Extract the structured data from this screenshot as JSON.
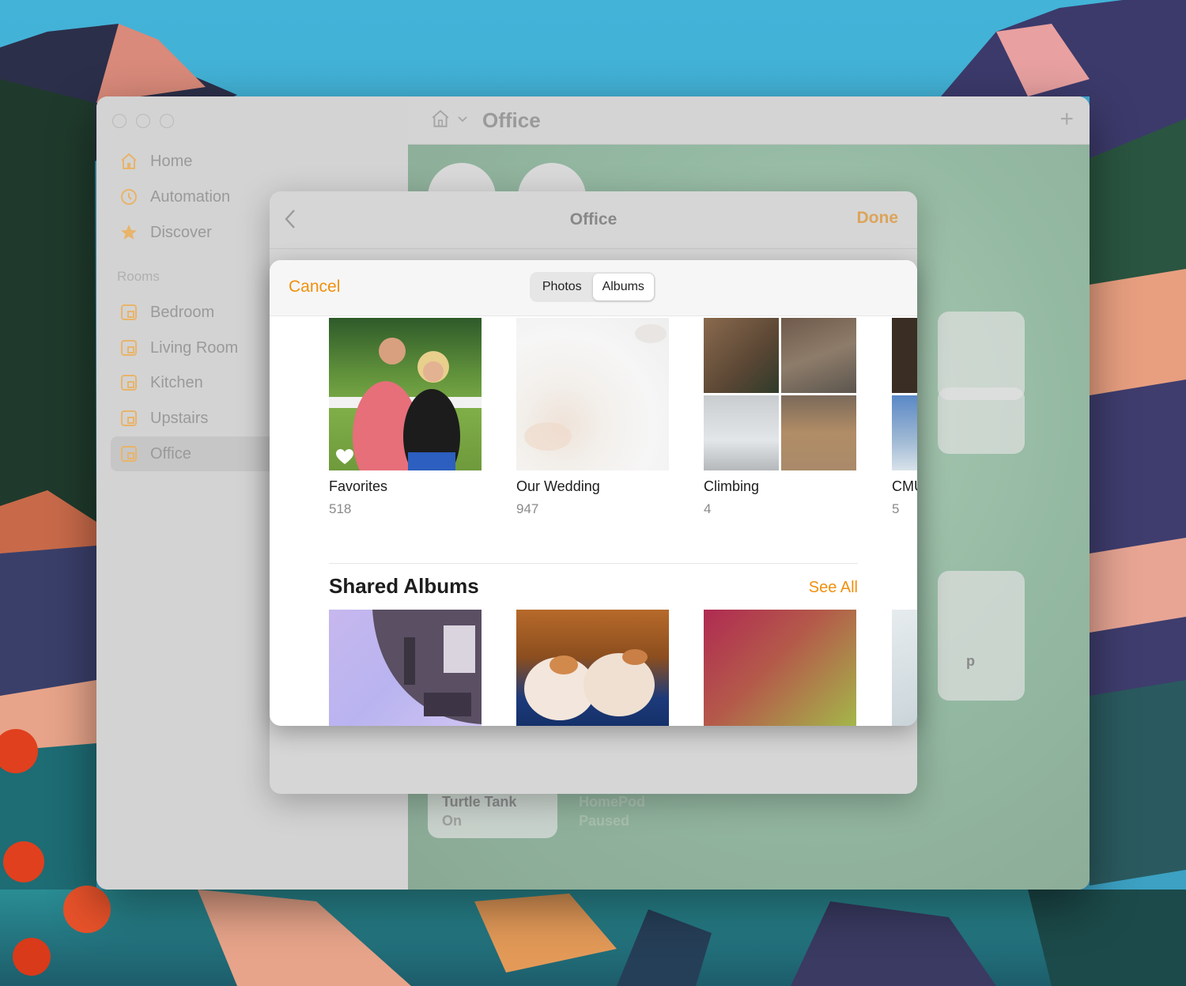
{
  "window": {
    "title": "Office"
  },
  "sidebar": {
    "items": [
      {
        "label": "Home",
        "icon": "house-icon"
      },
      {
        "label": "Automation",
        "icon": "clock-icon"
      },
      {
        "label": "Discover",
        "icon": "star-icon"
      }
    ],
    "rooms_header": "Rooms",
    "rooms": [
      {
        "label": "Bedroom"
      },
      {
        "label": "Living Room"
      },
      {
        "label": "Kitchen"
      },
      {
        "label": "Upstairs"
      },
      {
        "label": "Office",
        "selected": true
      }
    ]
  },
  "main": {
    "tiles": [
      {
        "name": "Turtle Tank",
        "status": "On"
      },
      {
        "name": "HomePod",
        "status": "Paused"
      }
    ],
    "partial_tile_text": "p"
  },
  "room_sheet": {
    "title": "Office",
    "done_label": "Done"
  },
  "picker": {
    "cancel_label": "Cancel",
    "segments": [
      {
        "label": "Photos",
        "active": false
      },
      {
        "label": "Albums",
        "active": true
      }
    ],
    "albums": [
      {
        "name": "Favorites",
        "count": "518"
      },
      {
        "name": "Our Wedding",
        "count": "947"
      },
      {
        "name": "Climbing",
        "count": "4"
      },
      {
        "name": "CMU",
        "count": "5"
      }
    ],
    "shared_title": "Shared Albums",
    "see_all_label": "See All"
  },
  "colors": {
    "accent": "#f0900e",
    "done_dimmed": "#dca45a"
  }
}
